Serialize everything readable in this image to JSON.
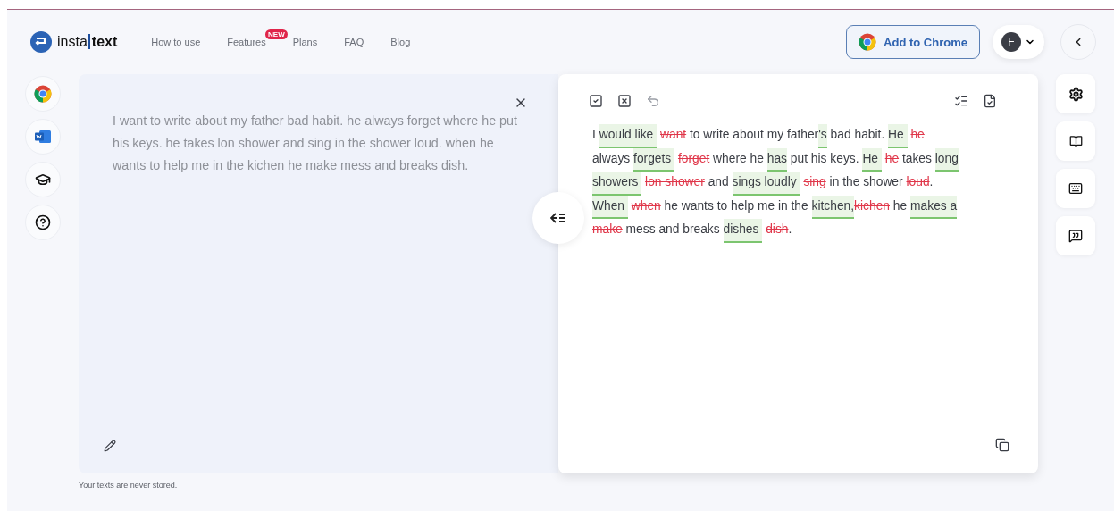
{
  "logo": {
    "part1": "insta",
    "part2": "text"
  },
  "nav": [
    {
      "label": "How to use"
    },
    {
      "label": "Features",
      "badge": "NEW"
    },
    {
      "label": "Plans"
    },
    {
      "label": "FAQ"
    },
    {
      "label": "Blog"
    }
  ],
  "chrome_button": "Add to Chrome",
  "avatar": "F",
  "input_text": "I want to write about my father bad habit. he always forget where he put his keys. he takes lon shower and sing in the shower loud. when he wants to help me in the kichen he make mess and breaks dish.",
  "output_lines": [
    {
      "segments": [
        {
          "kind": "plain",
          "text": "I"
        },
        {
          "kind": "added",
          "text": "would like",
          "space_after": true
        },
        {
          "kind": "removed",
          "text": "want"
        },
        {
          "kind": "plain",
          "text": "to write about my father"
        },
        {
          "kind": "added",
          "text": "'s"
        },
        {
          "kind": "plain",
          "text": "bad habit."
        },
        {
          "kind": "added",
          "text": "He",
          "space_after": true
        },
        {
          "kind": "removed",
          "text": "he"
        }
      ]
    },
    {
      "segments": [
        {
          "kind": "plain",
          "text": "always"
        },
        {
          "kind": "added",
          "text": "forgets",
          "space_after": true
        },
        {
          "kind": "removed",
          "text": "forget"
        },
        {
          "kind": "plain",
          "text": "where he"
        },
        {
          "kind": "added",
          "text": "has"
        },
        {
          "kind": "plain",
          "text": "put his keys."
        },
        {
          "kind": "added",
          "text": "He",
          "space_after": true
        },
        {
          "kind": "removed",
          "text": "he"
        },
        {
          "kind": "plain",
          "text": "takes"
        },
        {
          "kind": "added",
          "text": "long"
        }
      ]
    },
    {
      "segments": [
        {
          "kind": "added",
          "text": "showers",
          "space_after": true
        },
        {
          "kind": "removed",
          "text": "lon shower"
        },
        {
          "kind": "plain",
          "text": "and"
        },
        {
          "kind": "added",
          "text": "sings loudly",
          "space_after": true
        },
        {
          "kind": "removed",
          "text": "sing"
        },
        {
          "kind": "plain",
          "text": "in the shower"
        },
        {
          "kind": "removed",
          "text": "loud"
        },
        {
          "kind": "plain",
          "text": "."
        }
      ]
    },
    {
      "segments": [
        {
          "kind": "added",
          "text": "When",
          "space_after": true
        },
        {
          "kind": "removed",
          "text": "when"
        },
        {
          "kind": "plain",
          "text": "he wants to help me in the"
        },
        {
          "kind": "added",
          "text": "kitchen,"
        },
        {
          "kind": "removed",
          "text": "kichen"
        },
        {
          "kind": "plain",
          "text": "he"
        },
        {
          "kind": "added",
          "text": "makes a"
        }
      ]
    },
    {
      "segments": [
        {
          "kind": "removed",
          "text": "make"
        },
        {
          "kind": "plain",
          "text": "mess and breaks"
        },
        {
          "kind": "added",
          "text": "dishes",
          "space_after": true
        },
        {
          "kind": "removed",
          "text": "dish"
        },
        {
          "kind": "plain",
          "text": "."
        }
      ]
    }
  ],
  "footer_note": "Your texts are never stored."
}
